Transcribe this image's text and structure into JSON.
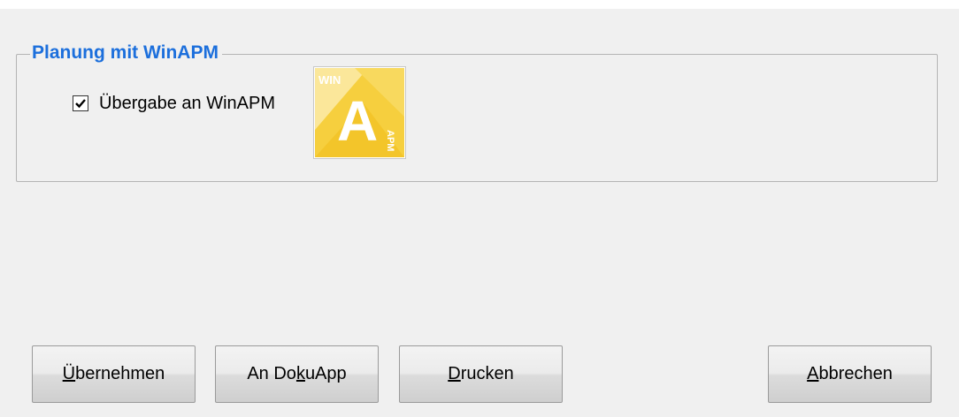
{
  "group": {
    "title": "Planung mit WinAPM"
  },
  "checkbox": {
    "label": "Übergabe an WinAPM",
    "checked": true
  },
  "logo": {
    "icon": "winapm-logo-icon",
    "text_top": "WIN",
    "text_main": "A",
    "text_side": "APM",
    "colors": {
      "base": "#f6cf3e",
      "light": "#fbe79a",
      "mid": "#f3c52a"
    }
  },
  "buttons": {
    "uebernehmen": {
      "pre": "",
      "acc": "Ü",
      "post": "bernehmen"
    },
    "dokuapp": {
      "pre": "An Do",
      "acc": "k",
      "post": "uApp"
    },
    "drucken": {
      "pre": "",
      "acc": "D",
      "post": "rucken"
    },
    "abbrechen": {
      "pre": "",
      "acc": "A",
      "post": "bbrechen"
    }
  },
  "colors": {
    "group_title": "#1c6fdc",
    "background": "#f0f0f0"
  }
}
